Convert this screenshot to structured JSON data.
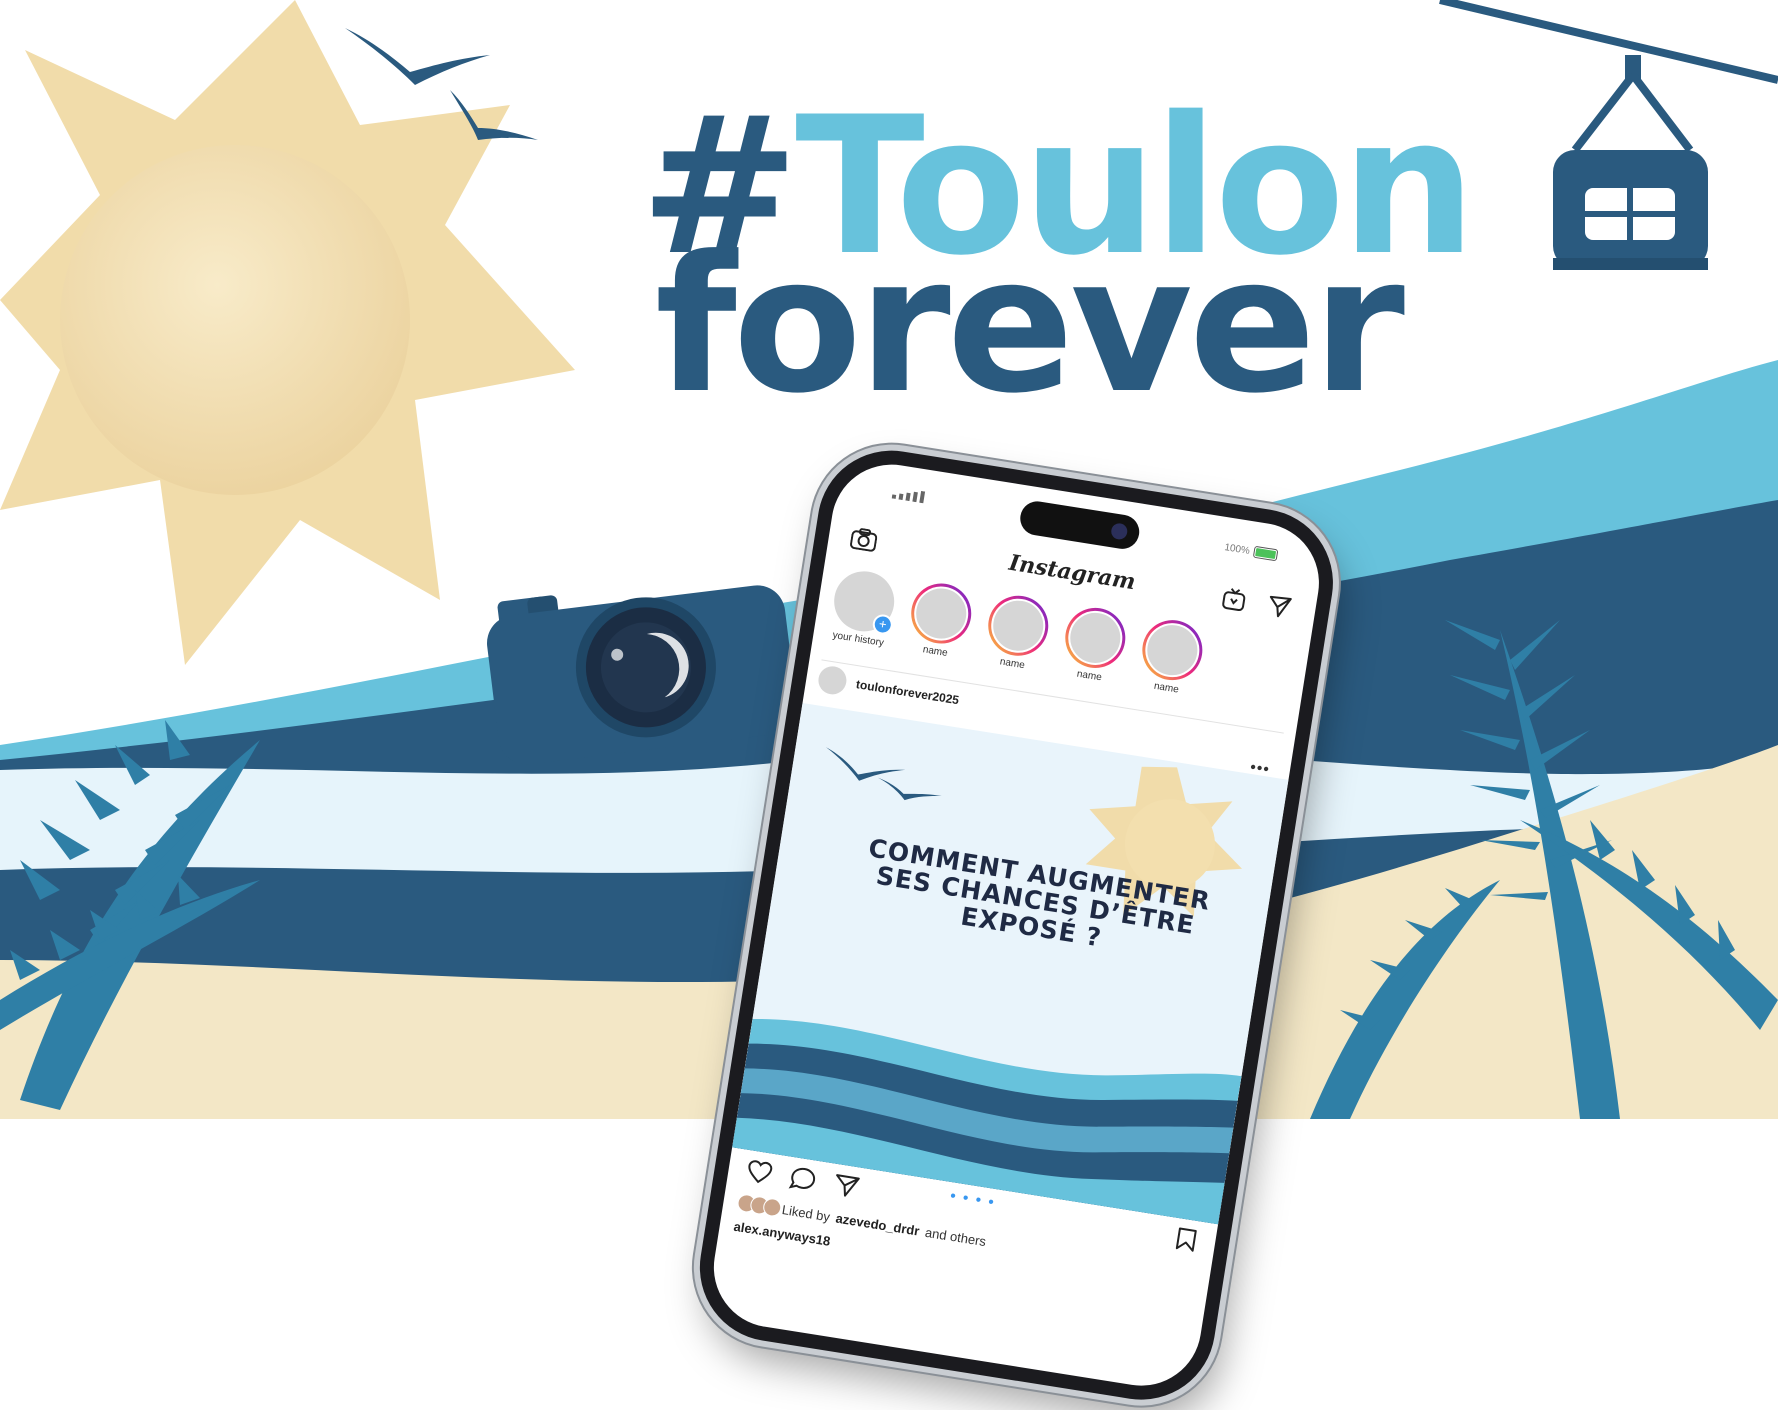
{
  "headline": {
    "hash": "#",
    "line1": "Toulon",
    "line2": "forever"
  },
  "colors": {
    "dark_blue": "#2a5a7f",
    "light_blue": "#67c2dc",
    "pale_blue": "#e6f4fb",
    "sand": "#f3e7c6",
    "sun": "#f1dcaa"
  },
  "icons": [
    "sun-icon",
    "birds-icon",
    "cable-car-icon",
    "camera-icon",
    "palm-leaf-icon",
    "smartphone"
  ],
  "phone": {
    "status": {
      "battery": "100%"
    },
    "app_name": "Instagram",
    "stories": [
      {
        "label": "your history"
      },
      {
        "label": "name"
      },
      {
        "label": "name"
      },
      {
        "label": "name"
      },
      {
        "label": "name"
      }
    ],
    "post": {
      "username": "toulonforever2025",
      "more": "•••",
      "title": "COMMENT AUGMENTER SES CHANCES D’ÊTRE EXPOSÉ ?",
      "likes_prefix": "Liked by",
      "likes_user": "azevedo_drdr",
      "likes_suffix": "and others",
      "caption_user": "alex.anyways18"
    }
  }
}
